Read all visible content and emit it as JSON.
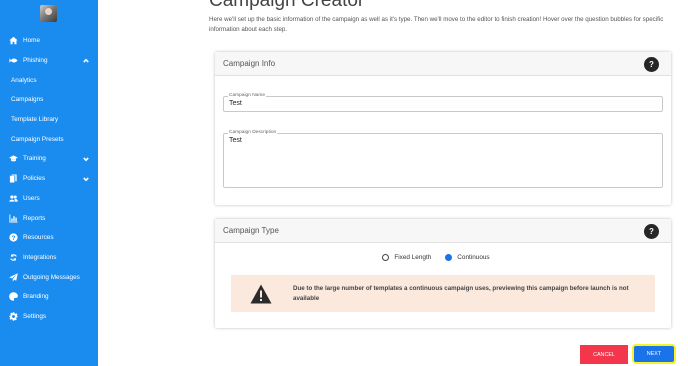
{
  "sidebar": {
    "items": [
      {
        "label": "Home",
        "icon": "home-icon"
      },
      {
        "label": "Phishing",
        "icon": "fish-icon",
        "expanded": true
      },
      {
        "label": "Analytics",
        "sub": true
      },
      {
        "label": "Campaigns",
        "sub": true
      },
      {
        "label": "Template Library",
        "sub": true
      },
      {
        "label": "Campaign Presets",
        "sub": true
      },
      {
        "label": "Training",
        "icon": "graduation-cap-icon",
        "expanded": false
      },
      {
        "label": "Policies",
        "icon": "documents-icon",
        "expanded": false
      },
      {
        "label": "Users",
        "icon": "users-icon"
      },
      {
        "label": "Reports",
        "icon": "bar-chart-icon"
      },
      {
        "label": "Resources",
        "icon": "question-circle-icon"
      },
      {
        "label": "Integrations",
        "icon": "sync-icon"
      },
      {
        "label": "Outgoing Messages",
        "icon": "paper-plane-icon"
      },
      {
        "label": "Branding",
        "icon": "palette-icon"
      },
      {
        "label": "Settings",
        "icon": "gear-icon"
      }
    ]
  },
  "main": {
    "title": "Campaign Creator",
    "intro": "Here we'll set up the basic information of the campaign as well as it's type. Then we'll move to the editor to finish creation! Hover over the question bubbles for specific information about each step."
  },
  "campaign_info": {
    "header": "Campaign Info",
    "help": "?",
    "name_label": "Campaign Name",
    "name_value": "Test",
    "description_label": "Campaign Description",
    "description_value": "Test"
  },
  "campaign_type": {
    "header": "Campaign Type",
    "help": "?",
    "options": [
      {
        "label": "Fixed Length",
        "checked": false
      },
      {
        "label": "Continuous",
        "checked": true
      }
    ],
    "warning": "Due to the large number of templates a continuous campaign uses, previewing this campaign before launch is not available"
  },
  "actions": {
    "cancel": "CANCEL",
    "next": "NEXT"
  },
  "colors": {
    "sidebar": "#1a8cf0",
    "cancel": "#f4364c",
    "next": "#1a73e8",
    "highlight": "#f5f32c",
    "warning_bg": "#fbe9dd"
  }
}
